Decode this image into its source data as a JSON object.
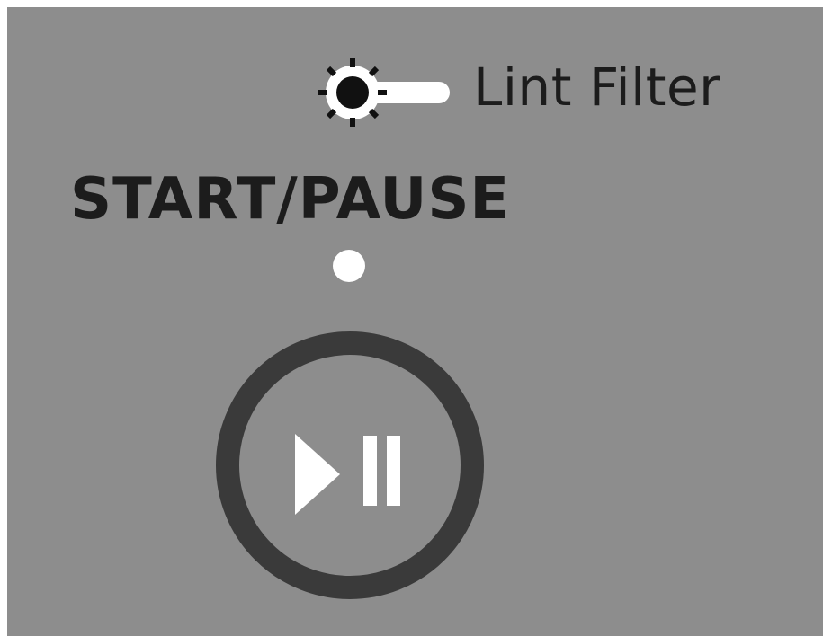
{
  "lint_filter": {
    "label": "Lint Filter",
    "indicator_icon": "sun-light-icon"
  },
  "start_pause": {
    "label": "START/PAUSE",
    "status_led_icon": "status-led-dot",
    "button_icon": "play-pause-icon"
  },
  "colors": {
    "panel_background": "#8d8d8d",
    "text": "#1c1c1c",
    "button_ring": "#3a3a3a",
    "symbol": "#ffffff"
  }
}
